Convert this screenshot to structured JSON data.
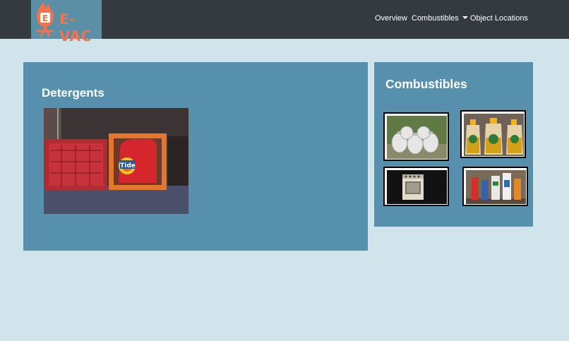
{
  "brand": {
    "name": "E-VAC",
    "logo_letter": "E"
  },
  "nav": {
    "overview": "Overview",
    "combustibles": "Combustibles",
    "object_locations": "Object Locations"
  },
  "main_panel": {
    "title": "Detergents",
    "image": {
      "icon": "detergent-image"
    }
  },
  "side_panel": {
    "title": "Combustibles",
    "thumbnails": [
      {
        "icon": "propane-tanks-image"
      },
      {
        "icon": "detergent-bottles-image"
      },
      {
        "icon": "stove-image"
      },
      {
        "icon": "aerosol-cans-image"
      }
    ]
  },
  "colors": {
    "navbar": "#343a40",
    "page_background": "#d1e4ec",
    "panel": "#5690ad",
    "logo_background": "#5a8fa6",
    "brand_orange": "#f0734d"
  }
}
